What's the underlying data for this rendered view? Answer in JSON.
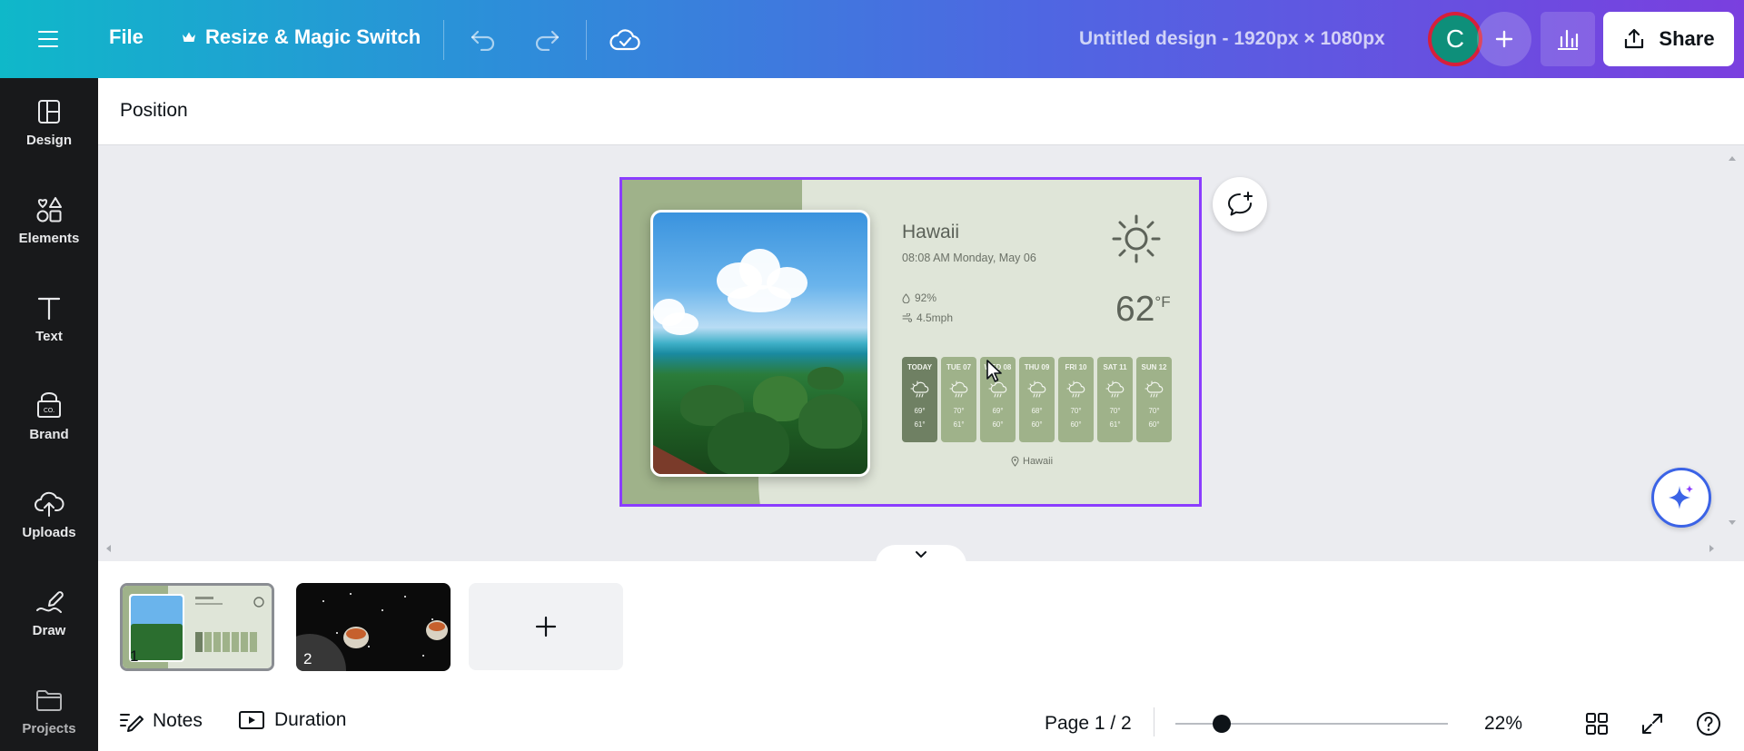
{
  "topbar": {
    "file_label": "File",
    "resize_label": "Resize & Magic Switch",
    "design_title": "Untitled design - 1920px × 1080px",
    "avatar_initial": "C",
    "share_label": "Share"
  },
  "sidebar": {
    "items": [
      {
        "label": "Design",
        "icon": "design-icon"
      },
      {
        "label": "Elements",
        "icon": "elements-icon"
      },
      {
        "label": "Text",
        "icon": "text-icon"
      },
      {
        "label": "Brand",
        "icon": "brand-icon"
      },
      {
        "label": "Uploads",
        "icon": "uploads-icon"
      },
      {
        "label": "Draw",
        "icon": "draw-icon"
      },
      {
        "label": "Projects",
        "icon": "projects-icon"
      }
    ]
  },
  "context_toolbar": {
    "position_label": "Position"
  },
  "design": {
    "city": "Hawaii",
    "datetime": "08:08 AM  Monday, May 06",
    "humidity": "92%",
    "wind": "4.5mph",
    "temperature": "62",
    "temp_unit": "°F",
    "location": "Hawaii",
    "forecast": [
      {
        "day": "TODAY",
        "hi": "69°",
        "lo": "61°"
      },
      {
        "day": "TUE 07",
        "hi": "70°",
        "lo": "61°"
      },
      {
        "day": "WED 08",
        "hi": "69°",
        "lo": "60°"
      },
      {
        "day": "THU 09",
        "hi": "68°",
        "lo": "60°"
      },
      {
        "day": "FRI 10",
        "hi": "70°",
        "lo": "60°"
      },
      {
        "day": "SAT 11",
        "hi": "70°",
        "lo": "61°"
      },
      {
        "day": "SUN 12",
        "hi": "70°",
        "lo": "60°"
      }
    ]
  },
  "pages": {
    "thumbs": [
      {
        "number": "1"
      },
      {
        "number": "2"
      }
    ]
  },
  "bottombar": {
    "notes_label": "Notes",
    "duration_label": "Duration",
    "page_indicator": "Page 1 / 2",
    "zoom_label": "22%",
    "zoom_fraction": 0.17
  },
  "colors": {
    "selection": "#8b3dff",
    "design_bg": "#dfe5d8",
    "design_green": "#9fb28a",
    "forecast_today": "#6f8063"
  }
}
